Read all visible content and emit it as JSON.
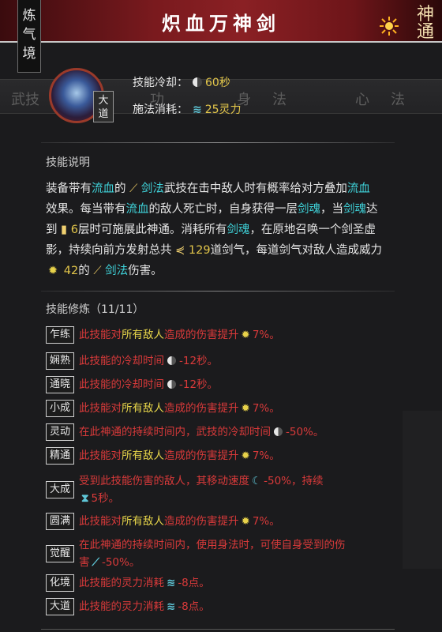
{
  "header": {
    "title": "炽血万神剑",
    "realm": "炼气境",
    "shentong_label": "神通"
  },
  "background": {
    "tabs": [
      "武技",
      "功",
      "身",
      "法",
      "心",
      "法"
    ]
  },
  "skill": {
    "rank": "大道",
    "cooldown_label": "技能冷却：",
    "cooldown_value": "60秒",
    "cost_label": "施法消耗：",
    "cost_value": "25灵力"
  },
  "description": {
    "title": "技能说明",
    "l1a": "装备带有",
    "l1b": "流血",
    "l1c": "的",
    "l1d": "剑法",
    "l1e": "武技在击中敌人时有概率给对方叠加",
    "l1f": "流血",
    "l2a": "效果。每当带有",
    "l2b": "流血",
    "l2c": "的敌人死亡时，自身获得一层",
    "l2d": "剑魂",
    "l2e": "，当",
    "l2f": "剑魂",
    "l2g": "达",
    "l3a": "到",
    "l3b": "6",
    "l3c": "层时可施展此神通。消耗所有",
    "l3d": "剑魂",
    "l3e": "，在原地召唤一个剑圣虚",
    "l4a": "影，持续向前方发射总共",
    "l4b": "129",
    "l4c": "道剑气，每道剑气对敌人造成威力",
    "l5a": "42",
    "l5b": "的",
    "l5c": "剑法",
    "l5d": "伤害。"
  },
  "training": {
    "title": "技能修炼（11/11）",
    "mods": [
      {
        "tag": "乍练",
        "a": "此技能对",
        "b": "所有敌人",
        "c": "造成的伤害提升",
        "v": "7%。"
      },
      {
        "tag": "娴熟",
        "a": "此技能的冷却时间",
        "v": "-12秒。"
      },
      {
        "tag": "通晓",
        "a": "此技能的冷却时间",
        "v": "-12秒。"
      },
      {
        "tag": "小成",
        "a": "此技能对",
        "b": "所有敌人",
        "c": "造成的伤害提升",
        "v": "7%。"
      },
      {
        "tag": "灵动",
        "a": "在此神通的持续时间内，武技的冷却时间",
        "v": "-50%。"
      },
      {
        "tag": "精通",
        "a": "此技能对",
        "b": "所有敌人",
        "c": "造成的伤害提升",
        "v": "7%。"
      },
      {
        "tag": "大成",
        "a": "受到此技能伤害的敌人，其移动速度",
        "v": "-50%，持续",
        "v2": "5秒。"
      },
      {
        "tag": "圆满",
        "a": "此技能对",
        "b": "所有敌人",
        "c": "造成的伤害提升",
        "v": "7%。"
      },
      {
        "tag": "觉醒",
        "a": "在此神通的持续时间内，使用身法时，可使自身受到的伤",
        "a2": "害",
        "v": "-50%。"
      },
      {
        "tag": "化境",
        "a": "此技能的灵力消耗",
        "v": "-8点。"
      },
      {
        "tag": "大道",
        "a": "此技能的灵力消耗",
        "v": "-8点。"
      }
    ]
  }
}
